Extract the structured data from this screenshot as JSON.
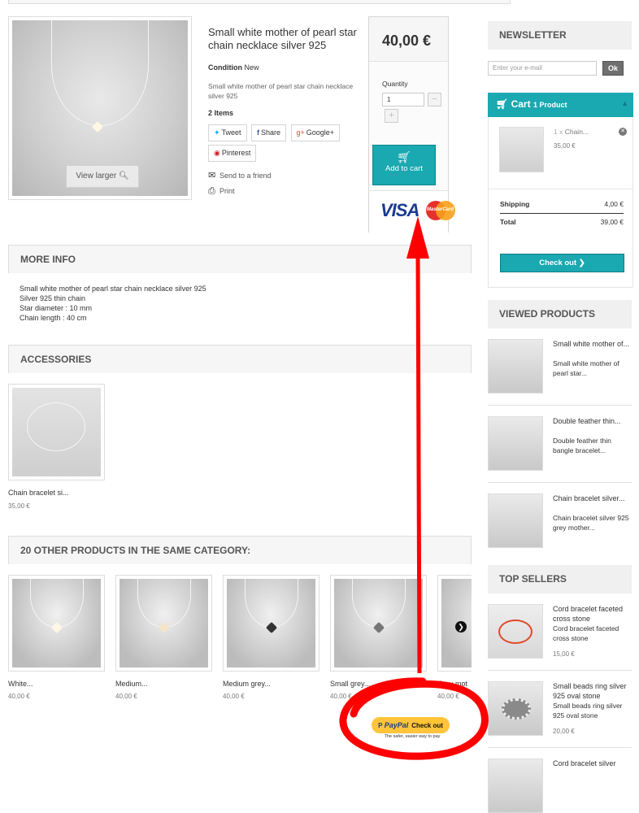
{
  "product": {
    "title": "Small white mother of pearl star chain necklace silver 925",
    "condition_label": "Condition",
    "condition_value": "New",
    "short_description": "Small white mother of pearl star chain necklace silver 925",
    "items_count": "2 Items",
    "view_larger": "View larger",
    "price": "40,00 €",
    "quantity_label": "Quantity",
    "quantity_value": "1",
    "add_to_cart": "Add to cart",
    "send_to_friend": "Send to a friend",
    "print": "Print",
    "share": {
      "tweet": "Tweet",
      "facebook": "Share",
      "google": "Google+",
      "pinterest": "Pinterest"
    },
    "visa_label": "VISA",
    "mastercard_label": "MasterCard"
  },
  "more_info": {
    "heading": "MORE INFO",
    "lines": [
      "Small white mother of pearl star chain necklace silver 925",
      "Silver 925 thin chain",
      "Star diameter : 10 mm",
      "Chain length : 40 cm"
    ]
  },
  "accessories": {
    "heading": "ACCESSORIES",
    "items": [
      {
        "name": "Chain bracelet si...",
        "price": "35,00 €"
      }
    ]
  },
  "same_category": {
    "heading": "20 OTHER PRODUCTS IN THE SAME CATEGORY:",
    "items": [
      {
        "name": "White...",
        "price": "40,00 €"
      },
      {
        "name": "Medium...",
        "price": "40,00 €"
      },
      {
        "name": "Medium grey...",
        "price": "40,00 €"
      },
      {
        "name": "Small grey...",
        "price": "40,00 €"
      },
      {
        "name": "Grey mot",
        "price": "40,00 €"
      }
    ]
  },
  "newsletter": {
    "heading": "NEWSLETTER",
    "placeholder": "Enter your e-mail",
    "ok": "Ok"
  },
  "cart": {
    "title": "Cart",
    "count": "1 Product",
    "line_qty": "1 x",
    "line_name": "Chain...",
    "line_price": "35,00 €",
    "shipping_label": "Shipping",
    "shipping_value": "4,00 €",
    "total_label": "Total",
    "total_value": "39,00 €",
    "checkout": "Check out"
  },
  "viewed_products": {
    "heading": "VIEWED PRODUCTS",
    "items": [
      {
        "title": "Small white mother of...",
        "desc": "Small white mother of pearl star..."
      },
      {
        "title": "Double feather thin...",
        "desc": "Double feather thin bangle bracelet..."
      },
      {
        "title": "Chain bracelet silver...",
        "desc": "Chain bracelet silver 925 grey mother..."
      }
    ]
  },
  "top_sellers": {
    "heading": "TOP SELLERS",
    "items": [
      {
        "title": "Cord bracelet faceted cross stone",
        "desc": "Cord bracelet faceted cross stone",
        "price": "15,00 €"
      },
      {
        "title": "Small beads ring silver 925 oval stone",
        "desc": "Small beads ring silver 925 oval stone",
        "price": "20,00 €"
      },
      {
        "title": "Cord bracelet silver",
        "desc": "",
        "price": ""
      }
    ]
  },
  "paypal": {
    "brand": "PayPal",
    "button": "Check out",
    "tagline": "The safer, easier way to pay"
  },
  "annotation": {
    "color": "#ff0000"
  },
  "colors": {
    "accent": "#1aa8b1",
    "heading_bg": "#f6f6f6"
  }
}
